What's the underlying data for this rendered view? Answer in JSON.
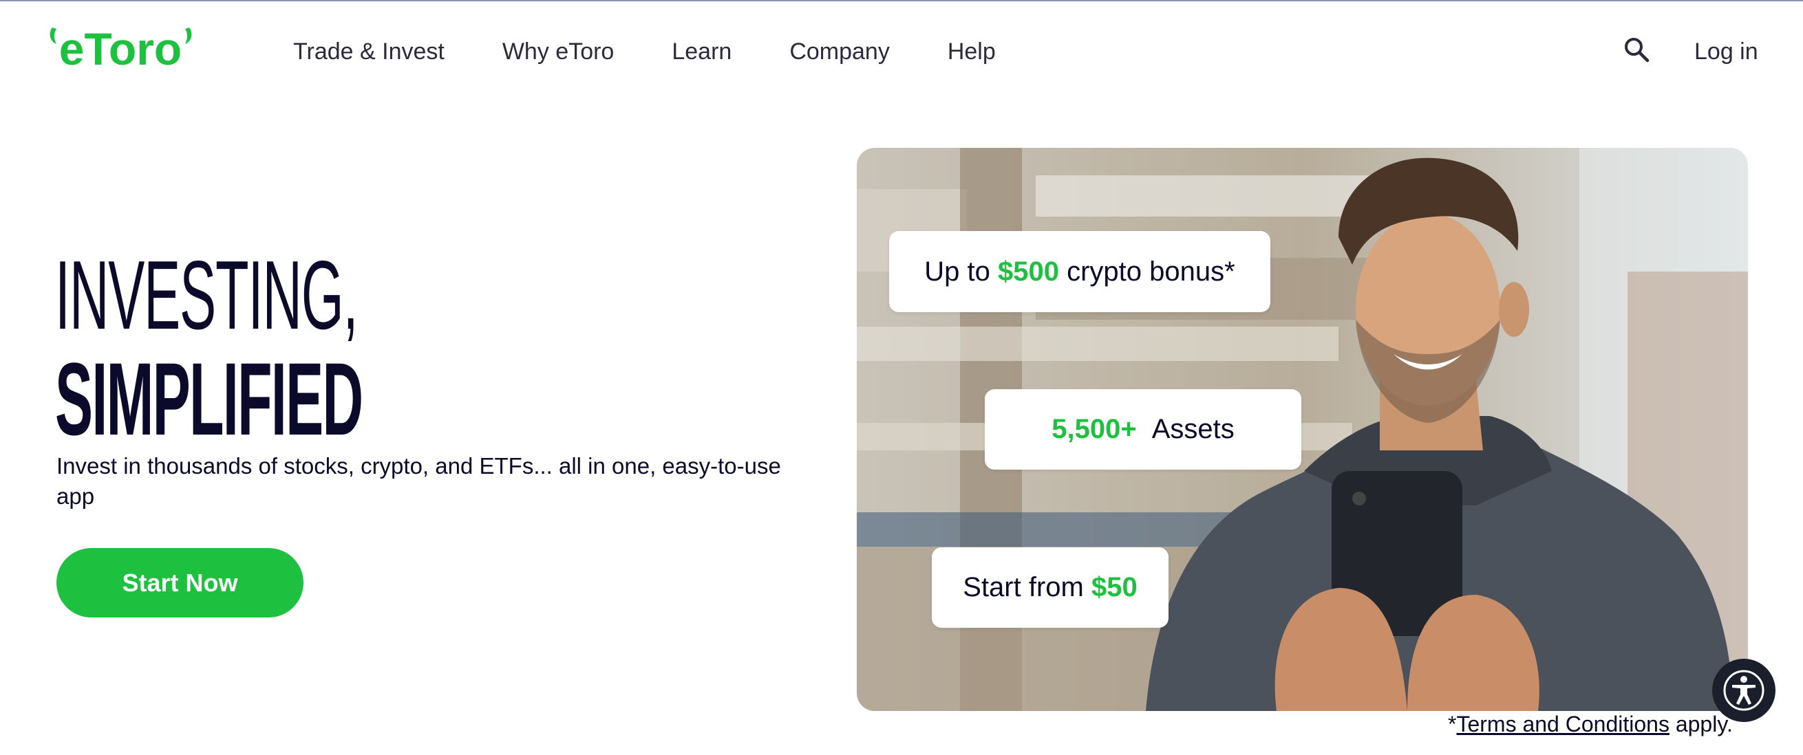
{
  "brand": {
    "logo_text": "eToro",
    "accent": "#1ec13f",
    "dark": "#0b0a2a"
  },
  "nav": {
    "items": [
      "Trade & Invest",
      "Why eToro",
      "Learn",
      "Company",
      "Help"
    ],
    "login_label": "Log in",
    "search_icon": "search-icon"
  },
  "hero": {
    "title_line1": "INVESTING,",
    "title_line2": "SIMPLIFIED",
    "subtitle": "Invest in thousands of stocks, crypto, and ETFs... all in one, easy-to-use app",
    "cta_label": "Start Now",
    "badges": {
      "bonus": {
        "prefix": "Up to ",
        "amount": "$500",
        "suffix": " crypto bonus*"
      },
      "assets": {
        "count": "5,500+",
        "label": "Assets"
      },
      "start": {
        "prefix": "Start from ",
        "amount": "$50"
      }
    },
    "terms": {
      "prefix": "*",
      "link": "Terms and Conditions",
      "suffix": " apply."
    }
  },
  "accessibility": {
    "icon": "accessibility-icon"
  }
}
